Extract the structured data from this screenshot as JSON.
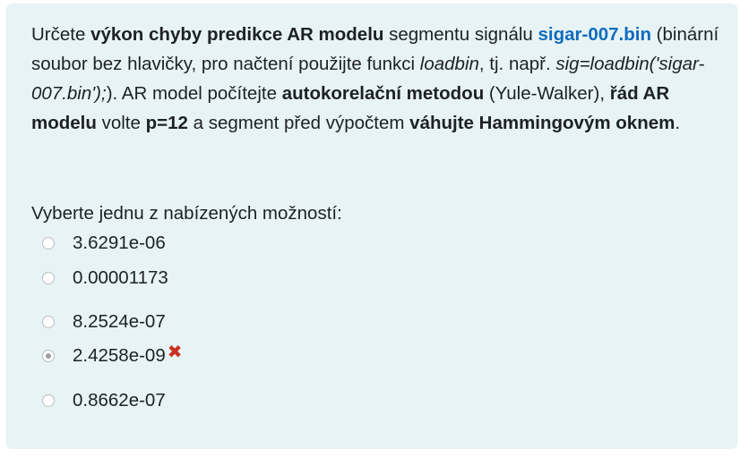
{
  "question": {
    "t1": "Určete ",
    "b1": "výkon chyby predikce AR modelu",
    "t2": " segmentu signálu ",
    "link": "sigar-007.bin",
    "t3": " (binární soubor bez hlavičky, pro načtení použijte funkci ",
    "i1": "loadbin",
    "t4": ", tj. např. ",
    "i2": "sig=loadbin('sigar-007.bin');",
    "t5": "). AR model počítejte ",
    "b2": "autokorelační metodou",
    "t6": " (Yule-Walker), ",
    "b3": "řád AR modelu",
    "t7": " volte ",
    "b4": "p=12",
    "t8": " a segment před výpočtem ",
    "b5": "váhujte Hammingovým oknem",
    "t9": "."
  },
  "prompt": "Vyberte jednu z nabízených možností:",
  "answers": [
    {
      "label": "3.6291e-06",
      "checked": false
    },
    {
      "label": "0.00001173",
      "checked": false
    },
    {
      "label": "8.2524e-07",
      "checked": false
    },
    {
      "label": "2.4258e-09",
      "checked": true,
      "feedback_icon": "incorrect-cross-icon",
      "feedback_glyph": "✖"
    },
    {
      "label": "0.8662e-07",
      "checked": false
    }
  ],
  "colors": {
    "panel_background": "#e7f3f5",
    "link": "#0f6cbf",
    "incorrect": "#ca3120"
  }
}
